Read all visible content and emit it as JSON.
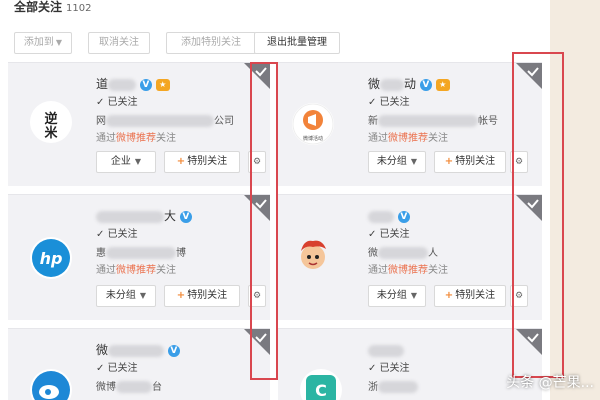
{
  "header": {
    "title": "全部关注",
    "count": "1102"
  },
  "toolbar": {
    "add_to": "添加到",
    "unfollow": "取消关注",
    "add_special": "添加特别关注",
    "exit_batch": "退出批量管理"
  },
  "cards": [
    {
      "name_visible": "道",
      "followed": "✓ 已关注",
      "desc_prefix": "网",
      "desc_suffix": "公司",
      "source_prefix": "通过",
      "source_highlight": "微博推荐",
      "source_suffix": "关注",
      "group": "企业",
      "special": "特别关注",
      "avatar_text": "逆米",
      "has_medal": true
    },
    {
      "name_visible": "微",
      "name_suffix": "动",
      "followed": "✓ 已关注",
      "desc_prefix": "新",
      "desc_suffix": "帐号",
      "source_prefix": "通过",
      "source_highlight": "微博推荐",
      "source_suffix": "关注",
      "group": "未分组",
      "special": "特别关注",
      "avatar_text": "微博活动",
      "has_medal": true
    },
    {
      "name_visible": "",
      "name_suffix": "大",
      "followed": "✓ 已关注",
      "desc_prefix": "惠",
      "desc_suffix": "博",
      "source_prefix": "通过",
      "source_highlight": "微博推荐",
      "source_suffix": "关注",
      "group": "未分组",
      "special": "特别关注",
      "avatar_text": "hp",
      "has_medal": false
    },
    {
      "name_visible": "",
      "followed": "✓ 已关注",
      "desc_prefix": "微",
      "desc_suffix": "人",
      "source_prefix": "通过",
      "source_highlight": "微博推荐",
      "source_suffix": "关注",
      "group": "未分组",
      "special": "特别关注",
      "avatar_text": "",
      "has_medal": false
    },
    {
      "name_visible": "微",
      "name_suffix": "台",
      "followed": "✓ 已关注",
      "desc_prefix": "微博",
      "desc_suffix": "台",
      "avatar_text": ""
    },
    {
      "name_visible": "",
      "followed": "✓ 已关注",
      "desc_prefix": "浙",
      "desc_suffix": "",
      "avatar_text": "C"
    }
  ],
  "watermark": "头条 @芒果...",
  "colors": {
    "highlight_box": "#d9474f",
    "source_highlight": "#eb7350",
    "verified": "#3a9ee8",
    "special_plus": "#f28a38"
  }
}
